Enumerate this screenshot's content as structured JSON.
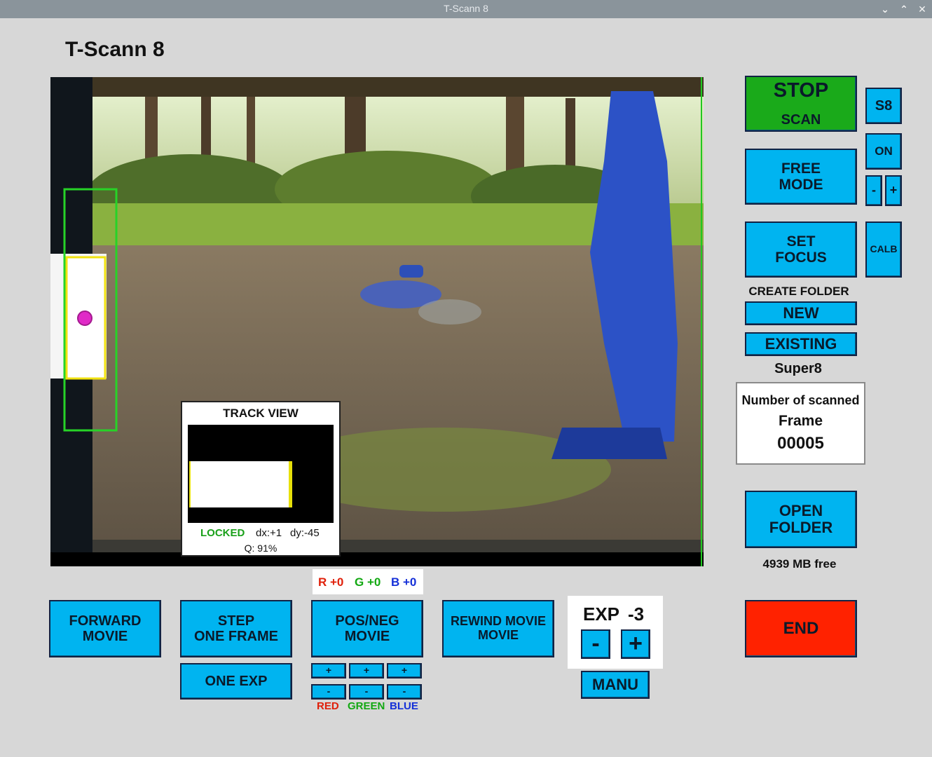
{
  "window": {
    "title": "T-Scann 8",
    "controls": [
      "⌄",
      "⌃",
      "✕"
    ]
  },
  "app": {
    "title": "T-Scann 8"
  },
  "track_view": {
    "title": "TRACK VIEW",
    "status": "LOCKED",
    "dx": "dx:+1",
    "dy": "dy:-45",
    "quality": "Q: 91%"
  },
  "rgb_offset": {
    "r": "R +0",
    "g": "G +0",
    "b": "B +0"
  },
  "buttons": {
    "forward_movie": "FORWARD\nMOVIE",
    "step_one_frame": "STEP\nONE FRAME",
    "pos_neg_movie": "POS/NEG\nMOVIE",
    "rewind_movie": "REWIND MOVIE\nMOVIE",
    "one_exp": "ONE EXP",
    "manu": "MANU",
    "stop_scan_1": "STOP",
    "stop_scan_2": "SCAN",
    "free_mode": "FREE\nMODE",
    "set_focus": "SET\nFOCUS",
    "new": "NEW",
    "existing": "EXISTING",
    "open_folder": "OPEN\nFOLDER",
    "end": "END",
    "s8": "S8",
    "on": "ON",
    "minus": "-",
    "plus": "+",
    "calb": "CALB"
  },
  "color_adjust": {
    "plus": "+",
    "minus": "-",
    "red": "RED",
    "green": "GREEN",
    "blue": "BLUE"
  },
  "exposure": {
    "label": "EXP",
    "value": "-3",
    "minus": "-",
    "plus": "+"
  },
  "folder": {
    "create_label": "CREATE FOLDER",
    "film_type": "Super8",
    "free_space": "4939 MB free"
  },
  "counter": {
    "label1": "Number of scanned",
    "label2": "Frame",
    "value": "00005"
  },
  "colors": {
    "accent": "#00b4f0",
    "stop": "#1aaa1a",
    "end": "#ff2200",
    "locked": "#1aa01a"
  }
}
